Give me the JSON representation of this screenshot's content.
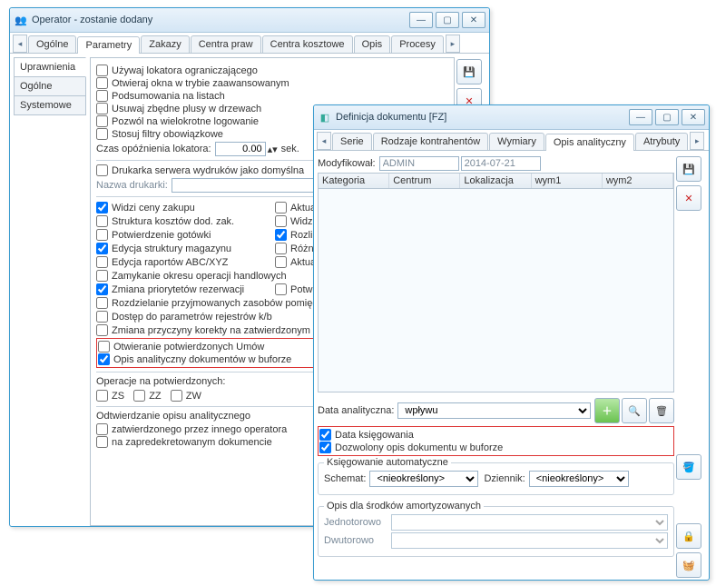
{
  "win1": {
    "title": "Operator - zostanie dodany",
    "tabs": [
      "Ogólne",
      "Parametry",
      "Zakazy",
      "Centra praw",
      "Centra kosztowe",
      "Opis",
      "Procesy"
    ],
    "activeTab": 1,
    "sideTabs": [
      "Uprawnienia",
      "Ogólne",
      "Systemowe"
    ],
    "activeSideTab": 0,
    "topChecks": [
      {
        "label": "Używaj lokatora ograniczającego",
        "checked": false
      },
      {
        "label": "Otwieraj okna w trybie zaawansowanym",
        "checked": false
      },
      {
        "label": "Podsumowania na listach",
        "checked": false
      },
      {
        "label": "Usuwaj zbędne plusy w drzewach",
        "checked": false
      },
      {
        "label": "Pozwól na wielokrotne logowanie",
        "checked": false
      },
      {
        "label": "Stosuj filtry obowiązkowe",
        "checked": false
      }
    ],
    "delayLabel": "Czas opóźnienia lokatora:",
    "delayValue": "0.00",
    "delayUnit": "sek.",
    "printerCheck": {
      "label": "Drukarka serwera wydruków jako domyślna",
      "checked": false
    },
    "printerNameLabel": "Nazwa drukarki:",
    "printerName": "",
    "midChecks": [
      {
        "label": "Widzi ceny zakupu",
        "checked": true
      },
      {
        "label": "Aktualizacja adre",
        "checked": false
      },
      {
        "label": "Struktura kosztów dod. zak.",
        "checked": false
      },
      {
        "label": "Widzi koszty",
        "checked": false
      },
      {
        "label": "Potwierdzenie gotówki",
        "checked": false
      },
      {
        "label": "Rozliczenie ka",
        "checked": true
      },
      {
        "label": "Edycja struktury magazynu",
        "checked": true
      },
      {
        "label": "Różnicow",
        "checked": false
      },
      {
        "label": "Edycja raportów ABC/XYZ",
        "checked": false
      },
      {
        "label": "Aktualiza",
        "checked": false
      },
      {
        "label": "Zamykanie okresu operacji handlowych",
        "checked": false
      },
      {
        "label": "Zmiana priorytetów rezerwacji",
        "checked": true
      },
      {
        "label": "Potwierd",
        "checked": false
      },
      {
        "label": "Rozdzielanie przyjmowanych zasobów pomięd",
        "checked": false
      },
      {
        "label": "Dostęp do parametrów rejestrów k/b",
        "checked": false
      },
      {
        "label": "Zmiana przyczyny korekty na zatwierdzonym",
        "checked": false
      }
    ],
    "openContracts": {
      "label": "Otwieranie potwierdzonych Umów",
      "checked": false
    },
    "bufferDoc": {
      "label": "Opis analityczny dokumentów w buforze",
      "checked": true
    },
    "opsLabel": "Operacje na potwierdzonych:",
    "opsChecks": [
      {
        "label": "ZS",
        "checked": false
      },
      {
        "label": "ZZ",
        "checked": false
      },
      {
        "label": "ZW",
        "checked": false
      }
    ],
    "restoreLabel": "Odtwierdzanie opisu analitycznego",
    "restoreChecks": [
      {
        "label": "zatwierdzonego przez innego operatora",
        "checked": false
      },
      {
        "label": "na zapredekretowanym dokumencie",
        "checked": false
      }
    ]
  },
  "win2": {
    "title": "Definicja dokumentu [FZ]",
    "tabs": [
      "Serie",
      "Rodzaje kontrahentów",
      "Wymiary",
      "Opis analityczny",
      "Atrybuty"
    ],
    "activeTab": 3,
    "modLabel": "Modyfikował:",
    "modUser": "ADMIN",
    "modDate": "2014-07-21",
    "cols": [
      "Kategoria",
      "Centrum",
      "Lokalizacja",
      "wym1",
      "wym2"
    ],
    "dateLabel": "Data analityczna:",
    "dateValue": "wpływu",
    "bookDate": {
      "label": "Data księgowania",
      "checked": true
    },
    "allowBuffer": {
      "label": "Dozwolony opis dokumentu w buforze",
      "checked": true
    },
    "autoBooking": {
      "legend": "Księgowanie automatyczne",
      "schemaLabel": "Schemat:",
      "schemaValue": "<nieokreślony>",
      "dziennikLabel": "Dziennik:",
      "dziennikValue": "<nieokreślony>"
    },
    "amort": {
      "legend": "Opis dla środków amortyzowanych",
      "oneLabel": "Jednotorowo",
      "oneValue": "",
      "twoLabel": "Dwutorowo",
      "twoValue": ""
    },
    "icons": {
      "save": "💾",
      "close": "✕",
      "add": "＋",
      "search": "🔍",
      "trash": "🗑",
      "bucket": "🪣",
      "lock": "🔒",
      "basket": "🧺"
    }
  }
}
